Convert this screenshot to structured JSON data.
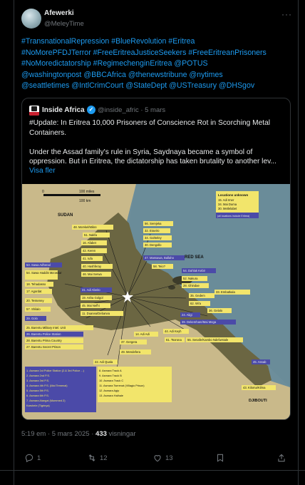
{
  "author": {
    "name": "Afewerki",
    "handle": "@MeleyTime"
  },
  "more_label": "···",
  "body_lines": [
    "#TransnationalRepression #BlueRevolution #Eritrea",
    "#NoMorePFDJTerror #FreeEritreaJusticeSeekers #FreeEritreanPrisoners",
    "#NoMoredictatorship #RegimechenginEritrea @POTUS",
    "@washingtonpost @BBCAfrica @thenewstribune @nytimes",
    "@seattletimes @IntlCrimCourt @StateDept @USTreasury @DHSgov"
  ],
  "quote": {
    "avatar_text": "INSIDE AFRICA",
    "name": "Inside Africa",
    "handle_date": "@inside_afric · 5 mars",
    "para1": [
      "#Update:  In Eritrea 10,000 Prisoners of Conscience Rot in Scorching Metal",
      "Containers."
    ],
    "para2": [
      "Under the Assad family's rule in Syria, Saydnaya became a symbol of",
      "oppression. But in Eritrea, the dictatorship has taken brutality to another lev..."
    ],
    "show_more": "Visa fler"
  },
  "map": {
    "scale_label": "100 miles",
    "scale_top": "0",
    "scale_km": "100 km",
    "country_sudan": "SUDAN",
    "sea_label": "RED SEA",
    "djibouti": "DJIBOUTI",
    "unknown_header": "Locations unknown",
    "unknown_items": [
      "15. Adi Imer",
      "34. Mai Duma",
      "30. Metlelabet"
    ],
    "unknown_note": "(all locations include Eritrea)",
    "north_labels": [
      "48. Ma'ekel/Mikre",
      "51. Nakfa",
      "16. Afabet",
      "42. Keren",
      "41. Iufa",
      "40. Hashferay",
      "46. Mai Serwa"
    ],
    "east_labels": [
      "56. Serejeka",
      "32. Eraeiro",
      "34. Gahteley",
      "30. Dengollo",
      "47. Massawa, Ballaho",
      "58. Teio?",
      "54. Dahlak Kebir",
      "52. Nakura",
      "28. Ghindae",
      "33. Embatkala",
      "35. Gedem",
      "62. Wi'a",
      "36. Gelalo",
      "24. Aligi",
      "39. Dekemhare/Mai Mega"
    ],
    "west_labels": [
      "53. Sawa Adhenal",
      "54. Sawa Haddis Ma'askar",
      "18. Tehadasso",
      "17. Agordat",
      "20. Tesseney",
      "57. Shilalo",
      "29. Golo"
    ],
    "center_labels": [
      "31. Adi Abeito",
      "19. Asha Golgol",
      "45. Mai Nefhi",
      "11. Duarwa/Debarwa",
      "44. Adi Keyh",
      "14. Adi Adi",
      "37. Gergera",
      "49. Mendefera",
      "61. Tsorona",
      "55. Senafe/Kambo Ndefurstale"
    ],
    "sw_labels": [
      "25. Barentu Military Intel. Unit",
      "26. Barentu Police Station",
      "28. Barentu Prima Country",
      "27. Barentu Secret Prison"
    ],
    "south_labels": [
      "22. Adi Quala",
      "45. Assab",
      "43. Kiloma/Kilma"
    ],
    "asmara_left": [
      "1. Asmara 1st Police Station (2.& 3rd Police ...)",
      "2. Asmara 2nd P.S.",
      "3. Asmara 3rd P.S.",
      "4. Asmara 4th P.S. (Mai Temenai)",
      "5. Asmara 5th P.S.",
      "6. Asmara 6th P.S.",
      "7. Asmara Alangai (Mummed 2)",
      "Karshele (Tigrinya)"
    ],
    "asmara_right": [
      "8. Asmara Track A",
      "9. Asmara Track B",
      "10. Asmara Track C",
      "11. Asmara Tserenat (Villagio Prison)",
      "12. Asmara Agip",
      "13. Asmara Halhale"
    ]
  },
  "meta": {
    "time": "5:19 em · 5 mars 2025 · ",
    "views_count": "433",
    "views_label": " visningar"
  },
  "actions": {
    "reply_count": "1",
    "retweet_count": "12",
    "like_count": "13"
  },
  "colors": {
    "link": "#1d9bf0",
    "muted": "#71767b",
    "text": "#e7e9ea",
    "border": "#2f3336",
    "map_yellow": "#f2e56b",
    "map_purple": "#4b4aa8"
  }
}
